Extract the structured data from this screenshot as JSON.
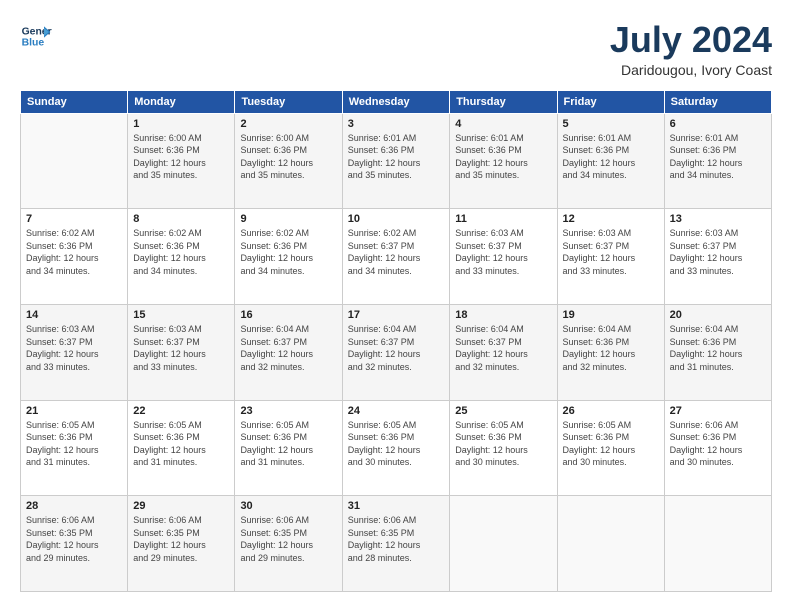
{
  "logo": {
    "line1": "General",
    "line2": "Blue"
  },
  "title": "July 2024",
  "location": "Daridougou, Ivory Coast",
  "days_of_week": [
    "Sunday",
    "Monday",
    "Tuesday",
    "Wednesday",
    "Thursday",
    "Friday",
    "Saturday"
  ],
  "weeks": [
    [
      {
        "day": "",
        "info": ""
      },
      {
        "day": "1",
        "info": "Sunrise: 6:00 AM\nSunset: 6:36 PM\nDaylight: 12 hours\nand 35 minutes."
      },
      {
        "day": "2",
        "info": "Sunrise: 6:00 AM\nSunset: 6:36 PM\nDaylight: 12 hours\nand 35 minutes."
      },
      {
        "day": "3",
        "info": "Sunrise: 6:01 AM\nSunset: 6:36 PM\nDaylight: 12 hours\nand 35 minutes."
      },
      {
        "day": "4",
        "info": "Sunrise: 6:01 AM\nSunset: 6:36 PM\nDaylight: 12 hours\nand 35 minutes."
      },
      {
        "day": "5",
        "info": "Sunrise: 6:01 AM\nSunset: 6:36 PM\nDaylight: 12 hours\nand 34 minutes."
      },
      {
        "day": "6",
        "info": "Sunrise: 6:01 AM\nSunset: 6:36 PM\nDaylight: 12 hours\nand 34 minutes."
      }
    ],
    [
      {
        "day": "7",
        "info": "Sunrise: 6:02 AM\nSunset: 6:36 PM\nDaylight: 12 hours\nand 34 minutes."
      },
      {
        "day": "8",
        "info": "Sunrise: 6:02 AM\nSunset: 6:36 PM\nDaylight: 12 hours\nand 34 minutes."
      },
      {
        "day": "9",
        "info": "Sunrise: 6:02 AM\nSunset: 6:36 PM\nDaylight: 12 hours\nand 34 minutes."
      },
      {
        "day": "10",
        "info": "Sunrise: 6:02 AM\nSunset: 6:37 PM\nDaylight: 12 hours\nand 34 minutes."
      },
      {
        "day": "11",
        "info": "Sunrise: 6:03 AM\nSunset: 6:37 PM\nDaylight: 12 hours\nand 33 minutes."
      },
      {
        "day": "12",
        "info": "Sunrise: 6:03 AM\nSunset: 6:37 PM\nDaylight: 12 hours\nand 33 minutes."
      },
      {
        "day": "13",
        "info": "Sunrise: 6:03 AM\nSunset: 6:37 PM\nDaylight: 12 hours\nand 33 minutes."
      }
    ],
    [
      {
        "day": "14",
        "info": "Sunrise: 6:03 AM\nSunset: 6:37 PM\nDaylight: 12 hours\nand 33 minutes."
      },
      {
        "day": "15",
        "info": "Sunrise: 6:03 AM\nSunset: 6:37 PM\nDaylight: 12 hours\nand 33 minutes."
      },
      {
        "day": "16",
        "info": "Sunrise: 6:04 AM\nSunset: 6:37 PM\nDaylight: 12 hours\nand 32 minutes."
      },
      {
        "day": "17",
        "info": "Sunrise: 6:04 AM\nSunset: 6:37 PM\nDaylight: 12 hours\nand 32 minutes."
      },
      {
        "day": "18",
        "info": "Sunrise: 6:04 AM\nSunset: 6:37 PM\nDaylight: 12 hours\nand 32 minutes."
      },
      {
        "day": "19",
        "info": "Sunrise: 6:04 AM\nSunset: 6:36 PM\nDaylight: 12 hours\nand 32 minutes."
      },
      {
        "day": "20",
        "info": "Sunrise: 6:04 AM\nSunset: 6:36 PM\nDaylight: 12 hours\nand 31 minutes."
      }
    ],
    [
      {
        "day": "21",
        "info": "Sunrise: 6:05 AM\nSunset: 6:36 PM\nDaylight: 12 hours\nand 31 minutes."
      },
      {
        "day": "22",
        "info": "Sunrise: 6:05 AM\nSunset: 6:36 PM\nDaylight: 12 hours\nand 31 minutes."
      },
      {
        "day": "23",
        "info": "Sunrise: 6:05 AM\nSunset: 6:36 PM\nDaylight: 12 hours\nand 31 minutes."
      },
      {
        "day": "24",
        "info": "Sunrise: 6:05 AM\nSunset: 6:36 PM\nDaylight: 12 hours\nand 30 minutes."
      },
      {
        "day": "25",
        "info": "Sunrise: 6:05 AM\nSunset: 6:36 PM\nDaylight: 12 hours\nand 30 minutes."
      },
      {
        "day": "26",
        "info": "Sunrise: 6:05 AM\nSunset: 6:36 PM\nDaylight: 12 hours\nand 30 minutes."
      },
      {
        "day": "27",
        "info": "Sunrise: 6:06 AM\nSunset: 6:36 PM\nDaylight: 12 hours\nand 30 minutes."
      }
    ],
    [
      {
        "day": "28",
        "info": "Sunrise: 6:06 AM\nSunset: 6:35 PM\nDaylight: 12 hours\nand 29 minutes."
      },
      {
        "day": "29",
        "info": "Sunrise: 6:06 AM\nSunset: 6:35 PM\nDaylight: 12 hours\nand 29 minutes."
      },
      {
        "day": "30",
        "info": "Sunrise: 6:06 AM\nSunset: 6:35 PM\nDaylight: 12 hours\nand 29 minutes."
      },
      {
        "day": "31",
        "info": "Sunrise: 6:06 AM\nSunset: 6:35 PM\nDaylight: 12 hours\nand 28 minutes."
      },
      {
        "day": "",
        "info": ""
      },
      {
        "day": "",
        "info": ""
      },
      {
        "day": "",
        "info": ""
      }
    ]
  ]
}
